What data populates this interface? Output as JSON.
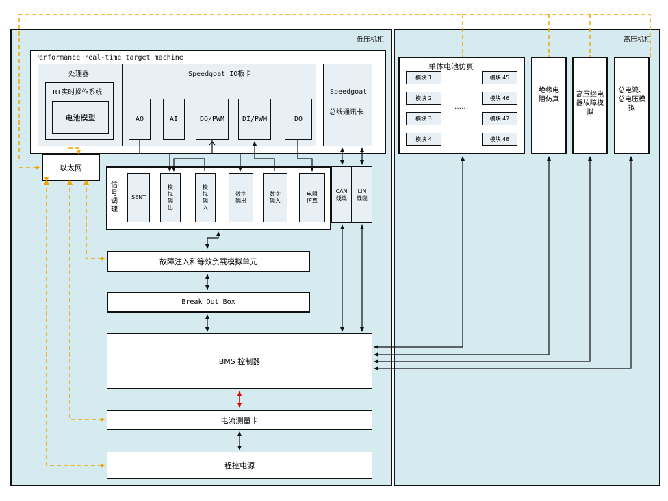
{
  "low_cabinet": {
    "label": "低压机柜"
  },
  "high_cabinet": {
    "label": "高压机柜"
  },
  "target_machine": {
    "title": "Performance real-time target machine"
  },
  "processor": {
    "title": "处理器",
    "os": "RT实时操作系统",
    "model": "电池模型"
  },
  "io_card": {
    "title": "Speedgoat IO板卡",
    "channels": [
      "AO",
      "AI",
      "DO/PWM",
      "DI/PWM",
      "DO"
    ]
  },
  "comm_card": {
    "line1": "Speedgoat",
    "line2": "总线通讯卡"
  },
  "ethernet": {
    "label": "以太网"
  },
  "signal_cond": {
    "label": "信号调理",
    "channels": [
      "SENT",
      "模拟输出",
      "模拟输入",
      "数字输出",
      "数字输入",
      "电阻仿真"
    ],
    "buses": [
      "CAN线缆",
      "LIN线缆"
    ]
  },
  "fault_unit": {
    "label": "故障注入和等效负载模拟单元"
  },
  "breakout": {
    "label": "Break Out Box"
  },
  "bms": {
    "label": "BMS 控制器"
  },
  "current_card": {
    "label": "电流测量卡"
  },
  "power_supply": {
    "label": "程控电源"
  },
  "cell_sim": {
    "title": "单体电池仿真",
    "left_modules": [
      "模块 1",
      "模块 2",
      "模块 3",
      "模块 4"
    ],
    "right_modules": [
      "模块 45",
      "模块 46",
      "模块 47",
      "模块 48"
    ],
    "ellipsis": "……"
  },
  "insulation": {
    "label": "绝缘电阻仿真"
  },
  "relay_fault": {
    "label": "高压继电器故障模拟"
  },
  "total_sim": {
    "label": "总电流、总电压模拟"
  },
  "colors": {
    "cabinet_fill": "#d6ebef",
    "box_fill": "#e8f0f5",
    "ethernet_link": "#f0a500",
    "highlight_arrow": "#e00000"
  }
}
